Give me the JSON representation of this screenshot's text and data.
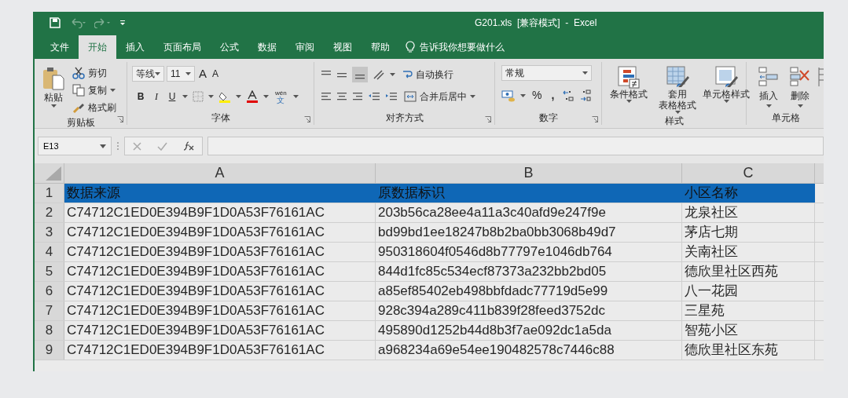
{
  "window": {
    "title": "G201.xls  [兼容模式]  -  Excel"
  },
  "tabs": [
    {
      "label": "文件",
      "selected": false
    },
    {
      "label": "开始",
      "selected": true
    },
    {
      "label": "插入",
      "selected": false
    },
    {
      "label": "页面布局",
      "selected": false
    },
    {
      "label": "公式",
      "selected": false
    },
    {
      "label": "数据",
      "selected": false
    },
    {
      "label": "审阅",
      "selected": false
    },
    {
      "label": "视图",
      "selected": false
    },
    {
      "label": "帮助",
      "selected": false
    }
  ],
  "tell_me": {
    "placeholder": "告诉我你想要做什么"
  },
  "ribbon": {
    "groups": [
      {
        "kind": "clipboard",
        "label": "剪贴板",
        "paste": "粘贴",
        "cut": "剪切",
        "copy": "复制",
        "format_painter": "格式刷"
      },
      {
        "kind": "font",
        "label": "字体",
        "font": "等线",
        "size": "11",
        "grow": "A",
        "shrink": "A",
        "bold": "B",
        "italic": "I",
        "underline": "U",
        "phonetic_top": "wén",
        "phonetic_bottom": "文"
      },
      {
        "kind": "alignment",
        "label": "对齐方式",
        "wrap": "自动换行",
        "merge": "合并后居中"
      },
      {
        "kind": "number",
        "label": "数字",
        "format": "常规",
        "percent": "%",
        "comma": ","
      },
      {
        "kind": "styles",
        "label": "样式",
        "buttons": [
          [
            "条件格式"
          ],
          [
            "套用",
            "表格格式"
          ],
          [
            "单元格样式"
          ]
        ]
      },
      {
        "kind": "cells",
        "label": "单元格",
        "buttons": [
          "插入",
          "删除"
        ]
      }
    ]
  },
  "name_box": {
    "value": "E13"
  },
  "sheet": {
    "columns": [
      "A",
      "B",
      "C"
    ],
    "rows": [
      {
        "number": "1",
        "highlighted": true,
        "cells": [
          "数据来源",
          "原数据标识",
          "小区名称"
        ]
      },
      {
        "number": "2",
        "highlighted": false,
        "cells": [
          "C74712C1ED0E394B9F1D0A53F76161AC",
          "203b56ca28ee4a11a3c40afd9e247f9e",
          "龙泉社区"
        ]
      },
      {
        "number": "3",
        "highlighted": false,
        "cells": [
          "C74712C1ED0E394B9F1D0A53F76161AC",
          "bd99bd1ee18247b8b2ba0bb3068b49d7",
          "茅店七期"
        ]
      },
      {
        "number": "4",
        "highlighted": false,
        "cells": [
          "C74712C1ED0E394B9F1D0A53F76161AC",
          "950318604f0546d8b77797e1046db764",
          "关南社区"
        ]
      },
      {
        "number": "5",
        "highlighted": false,
        "cells": [
          "C74712C1ED0E394B9F1D0A53F76161AC",
          "844d1fc85c534ecf87373a232bb2bd05",
          "德欣里社区西苑"
        ]
      },
      {
        "number": "6",
        "highlighted": false,
        "cells": [
          "C74712C1ED0E394B9F1D0A53F76161AC",
          "a85ef85402eb498bbfdadc77719d5e99",
          "八一花园"
        ]
      },
      {
        "number": "7",
        "highlighted": false,
        "cells": [
          "C74712C1ED0E394B9F1D0A53F76161AC",
          "928c394a289c411b839f28feed3752dc",
          "三星苑"
        ]
      },
      {
        "number": "8",
        "highlighted": false,
        "cells": [
          "C74712C1ED0E394B9F1D0A53F76161AC",
          "495890d1252b44d8b3f7ae092dc1a5da",
          "智苑小区"
        ]
      },
      {
        "number": "9",
        "highlighted": false,
        "cells": [
          "C74712C1ED0E394B9F1D0A53F76161AC",
          "a968234a69e54ee190482578c7446c88",
          "德欣里社区东苑"
        ]
      }
    ]
  }
}
